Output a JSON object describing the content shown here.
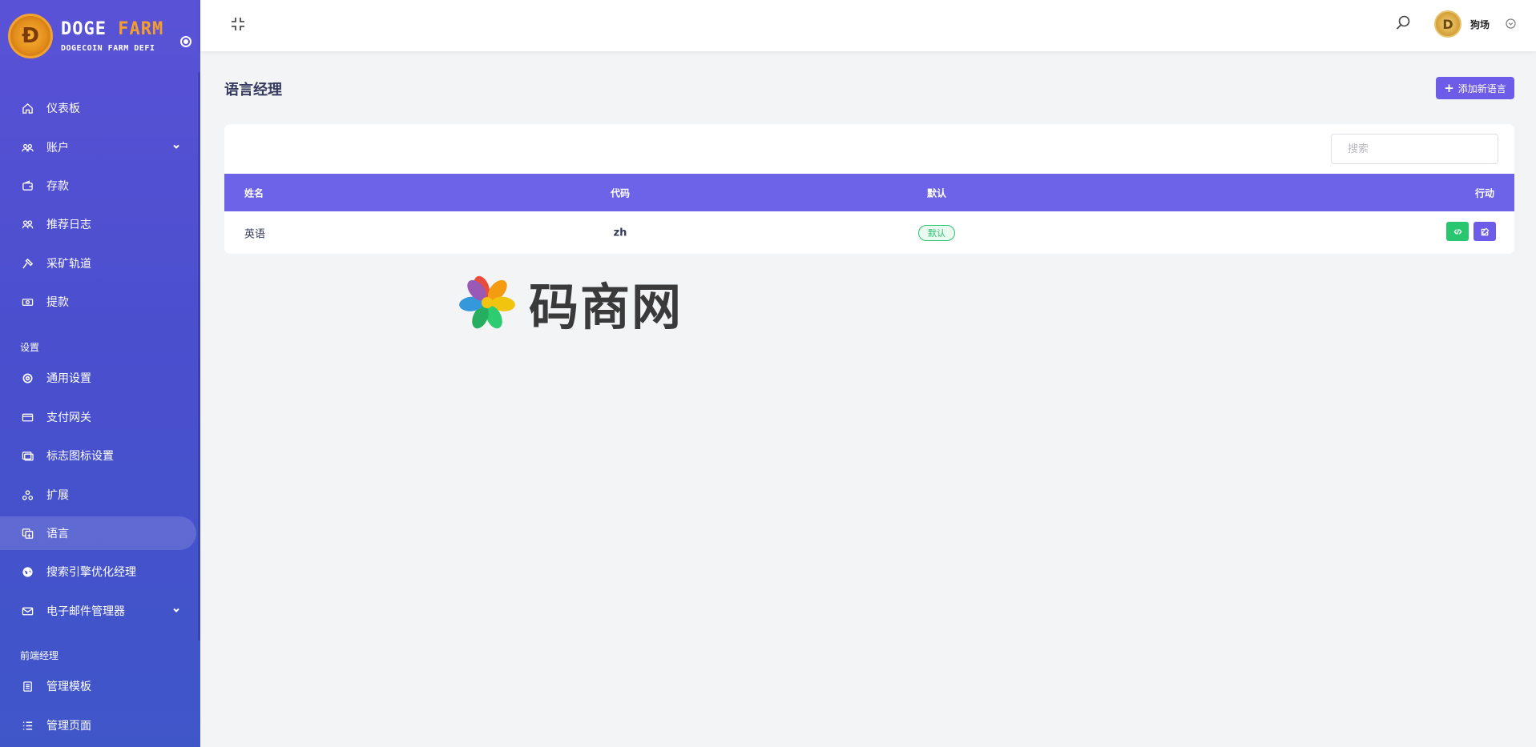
{
  "brand": {
    "title_a": "DOGE",
    "title_b": "FARM",
    "subtitle": "DOGECOIN FARM DEFI"
  },
  "sidebar": {
    "items": [
      {
        "label": "仪表板",
        "icon": "home-icon"
      },
      {
        "label": "账户",
        "icon": "users-icon",
        "has_submenu": true
      },
      {
        "label": "存款",
        "icon": "wallet-icon"
      },
      {
        "label": "推荐日志",
        "icon": "referral-icon"
      },
      {
        "label": "采矿轨道",
        "icon": "hammer-icon"
      },
      {
        "label": "提款",
        "icon": "cash-icon"
      }
    ],
    "settings_header": "设置",
    "settings_items": [
      {
        "label": "通用设置",
        "icon": "settings-icon"
      },
      {
        "label": "支付网关",
        "icon": "credit-card-icon"
      },
      {
        "label": "标志图标设置",
        "icon": "image-icon"
      },
      {
        "label": "扩展",
        "icon": "extension-icon"
      },
      {
        "label": "语言",
        "icon": "language-icon",
        "active": true
      },
      {
        "label": "搜索引擎优化经理",
        "icon": "globe-icon"
      },
      {
        "label": "电子邮件管理器",
        "icon": "mail-icon",
        "has_submenu": true
      }
    ],
    "frontend_header": "前端经理",
    "frontend_items": [
      {
        "label": "管理模板",
        "icon": "template-icon"
      },
      {
        "label": "管理页面",
        "icon": "list-icon"
      }
    ]
  },
  "topbar": {
    "user_name": "狗场"
  },
  "main": {
    "title": "语言经理",
    "add_button": "添加新语言",
    "search_placeholder": "搜索",
    "table": {
      "headers": [
        "姓名",
        "代码",
        "默认",
        "行动"
      ],
      "rows": [
        {
          "name": "英语",
          "code": "zh",
          "default_badge": "默认"
        }
      ]
    }
  },
  "watermark": {
    "text": "码商网"
  },
  "colors": {
    "accent": "#6c63e8",
    "success": "#28c76f",
    "sidebar": "#4a4fce"
  }
}
